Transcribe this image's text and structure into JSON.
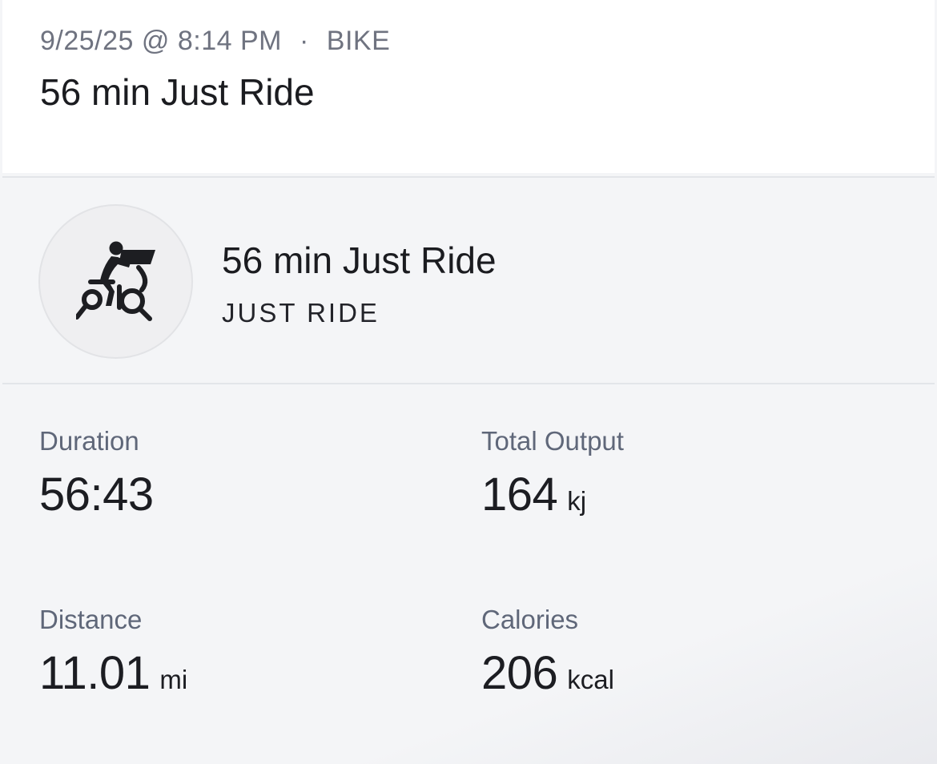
{
  "header": {
    "date_time": "9/25/25 @ 8:14 PM",
    "separator": "·",
    "discipline": "BIKE",
    "title": "56 min Just Ride"
  },
  "class_card": {
    "icon": "bike-just-ride-icon",
    "title": "56 min Just Ride",
    "subtitle": "JUST RIDE"
  },
  "stats": {
    "duration": {
      "label": "Duration",
      "value": "56:43",
      "unit": ""
    },
    "total_output": {
      "label": "Total Output",
      "value": "164",
      "unit": "kj"
    },
    "distance": {
      "label": "Distance",
      "value": "11.01",
      "unit": "mi"
    },
    "calories": {
      "label": "Calories",
      "value": "206",
      "unit": "kcal"
    }
  },
  "colors": {
    "background": "#f4f5f7",
    "card": "#ffffff",
    "meta_text": "#6f7380",
    "label_text": "#5f6779",
    "primary_text": "#1c1d22"
  }
}
